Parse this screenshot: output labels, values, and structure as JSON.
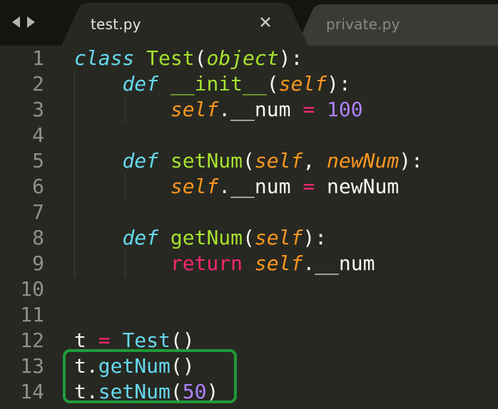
{
  "tabs": [
    {
      "label": "test.py",
      "active": true
    },
    {
      "label": "private.py",
      "active": false
    }
  ],
  "icons": {
    "back": "triangle-left-icon",
    "forward": "triangle-right-icon",
    "close": "close-icon"
  },
  "colors": {
    "background": "#272822",
    "tabbar": "#15150f",
    "active_tab": "#272822",
    "inactive_tab": "#3a3b35",
    "keyword": "#66d9ef",
    "class_function": "#a6e22e",
    "parameter": "#fd971f",
    "operator": "#f92672",
    "number": "#ae81ff",
    "highlight_box": "#1f9a3a"
  },
  "editor": {
    "line_numbers": [
      "1",
      "2",
      "3",
      "4",
      "5",
      "6",
      "7",
      "8",
      "9",
      "10",
      "11",
      "12",
      "13",
      "14"
    ],
    "lines": [
      {
        "tokens": [
          {
            "t": "class",
            "c": "kw-storage"
          },
          {
            "t": " ",
            "c": "plain"
          },
          {
            "t": "Test",
            "c": "cls"
          },
          {
            "t": "(",
            "c": "plain"
          },
          {
            "t": "object",
            "c": "inh"
          },
          {
            "t": "):",
            "c": "plain"
          }
        ]
      },
      {
        "tokens": [
          {
            "t": "    ",
            "c": "plain"
          },
          {
            "t": "def",
            "c": "kw-storage"
          },
          {
            "t": " ",
            "c": "plain"
          },
          {
            "t": "__init__",
            "c": "fn"
          },
          {
            "t": "(",
            "c": "plain"
          },
          {
            "t": "self",
            "c": "param"
          },
          {
            "t": "):",
            "c": "plain"
          }
        ]
      },
      {
        "tokens": [
          {
            "t": "        ",
            "c": "plain"
          },
          {
            "t": "self",
            "c": "selfvar"
          },
          {
            "t": ".__num ",
            "c": "plain"
          },
          {
            "t": "=",
            "c": "op"
          },
          {
            "t": " ",
            "c": "plain"
          },
          {
            "t": "100",
            "c": "num"
          }
        ]
      },
      {
        "tokens": []
      },
      {
        "tokens": [
          {
            "t": "    ",
            "c": "plain"
          },
          {
            "t": "def",
            "c": "kw-storage"
          },
          {
            "t": " ",
            "c": "plain"
          },
          {
            "t": "setNum",
            "c": "fn"
          },
          {
            "t": "(",
            "c": "plain"
          },
          {
            "t": "self",
            "c": "param"
          },
          {
            "t": ", ",
            "c": "plain"
          },
          {
            "t": "newNum",
            "c": "param"
          },
          {
            "t": "):",
            "c": "plain"
          }
        ]
      },
      {
        "tokens": [
          {
            "t": "        ",
            "c": "plain"
          },
          {
            "t": "self",
            "c": "selfvar"
          },
          {
            "t": ".__num ",
            "c": "plain"
          },
          {
            "t": "=",
            "c": "op"
          },
          {
            "t": " newNum",
            "c": "plain"
          }
        ]
      },
      {
        "tokens": []
      },
      {
        "tokens": [
          {
            "t": "    ",
            "c": "plain"
          },
          {
            "t": "def",
            "c": "kw-storage"
          },
          {
            "t": " ",
            "c": "plain"
          },
          {
            "t": "getNum",
            "c": "fn"
          },
          {
            "t": "(",
            "c": "plain"
          },
          {
            "t": "self",
            "c": "param"
          },
          {
            "t": "):",
            "c": "plain"
          }
        ]
      },
      {
        "tokens": [
          {
            "t": "        ",
            "c": "plain"
          },
          {
            "t": "return",
            "c": "kw-return"
          },
          {
            "t": " ",
            "c": "plain"
          },
          {
            "t": "self",
            "c": "selfvar"
          },
          {
            "t": ".__num",
            "c": "plain"
          }
        ]
      },
      {
        "tokens": []
      },
      {
        "tokens": []
      },
      {
        "tokens": [
          {
            "t": "t ",
            "c": "plain"
          },
          {
            "t": "=",
            "c": "op"
          },
          {
            "t": " ",
            "c": "plain"
          },
          {
            "t": "Test",
            "c": "builtin"
          },
          {
            "t": "()",
            "c": "plain"
          }
        ]
      },
      {
        "tokens": [
          {
            "t": "t.",
            "c": "plain"
          },
          {
            "t": "getNum",
            "c": "builtin"
          },
          {
            "t": "()",
            "c": "plain"
          }
        ]
      },
      {
        "tokens": [
          {
            "t": "t.",
            "c": "plain"
          },
          {
            "t": "setNum",
            "c": "builtin"
          },
          {
            "t": "(",
            "c": "plain"
          },
          {
            "t": "50",
            "c": "num"
          },
          {
            "t": ")",
            "c": "plain"
          }
        ]
      }
    ]
  }
}
